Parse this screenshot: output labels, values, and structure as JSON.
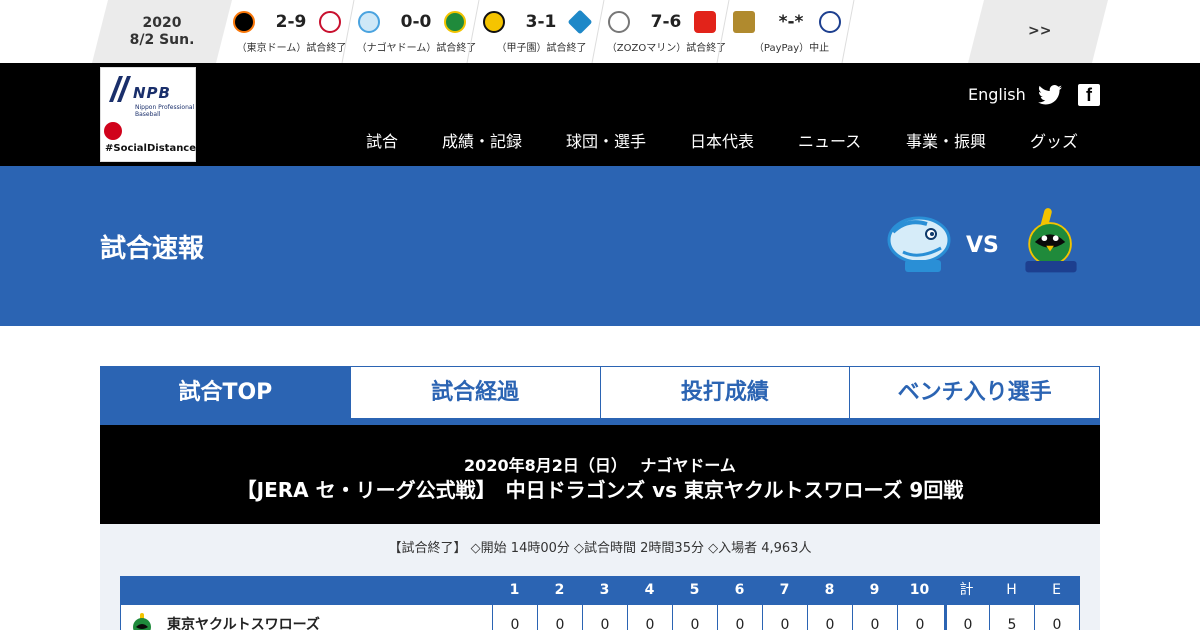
{
  "ticker": {
    "year": "2020",
    "day": "8/2 Sun.",
    "games": [
      {
        "score": "2-9",
        "note": "（東京ドーム）試合終了",
        "home_color": "#f97709",
        "away_color": "#c8102e"
      },
      {
        "score": "0-0",
        "note": "（ナゴヤドーム）試合終了",
        "home_color": "#4aa3df",
        "away_color": "#1f8a3b"
      },
      {
        "score": "3-1",
        "note": "（甲子園）試合終了",
        "home_color": "#f5c400",
        "away_color": "#1e88c8"
      },
      {
        "score": "7-6",
        "note": "（ZOZOマリン）試合終了",
        "home_color": "#777777",
        "away_color": "#e2231a"
      },
      {
        "score": "*-*",
        "note": "（PayPay）中止",
        "home_color": "#b08a2e",
        "away_color": "#1d3f8f"
      }
    ],
    "more": ">>"
  },
  "header": {
    "logo_mark": "NPB",
    "logo_sub": "Nippon Professional Baseball",
    "logo_tag": "#SocialDistance",
    "lang": "English",
    "nav": [
      "試合",
      "成績・記録",
      "球団・選手",
      "日本代表",
      "ニュース",
      "事業・振興",
      "グッズ"
    ]
  },
  "hero": {
    "title": "試合速報",
    "vs": "VS",
    "home_logo": "dragons-logo",
    "away_logo": "swallows-logo"
  },
  "tabs": [
    {
      "label": "試合TOP",
      "active": true
    },
    {
      "label": "試合経過",
      "active": false
    },
    {
      "label": "投打成績",
      "active": false
    },
    {
      "label": "ベンチ入り選手",
      "active": false
    }
  ],
  "game": {
    "line1": "2020年8月2日（日）　 ナゴヤドーム",
    "line2": "【JERA セ・リーグ公式戦】　中日ドラゴンズ vs 東京ヤクルトスワローズ 9回戦",
    "status": "【試合終了】 ◇開始 14時00分 ◇試合時間 2時間35分 ◇入場者 4,963人"
  },
  "scoreboard": {
    "innings": [
      "1",
      "2",
      "3",
      "4",
      "5",
      "6",
      "7",
      "8",
      "9",
      "10"
    ],
    "totals_headers": [
      "計",
      "H",
      "E"
    ],
    "rows": [
      {
        "team": "東京ヤクルトスワローズ",
        "innings": [
          "0",
          "0",
          "0",
          "0",
          "0",
          "0",
          "0",
          "0",
          "0",
          "0"
        ],
        "totals": [
          "0",
          "5",
          "0"
        ]
      }
    ]
  },
  "colors": {
    "brand_blue": "#2b64b3",
    "header_black": "#000000",
    "panel": "#eef2f7"
  }
}
